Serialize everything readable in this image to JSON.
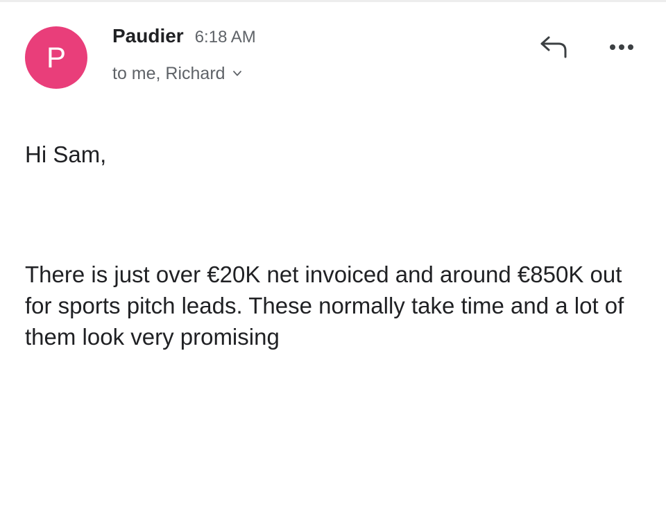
{
  "email": {
    "sender": {
      "initial": "P",
      "name": "Paudier",
      "time": "6:18 AM",
      "avatar_color": "#e93e7a"
    },
    "recipients": "to me, Richard",
    "actions": {
      "reply_icon": "reply-icon",
      "more_icon": "more-horizontal-icon"
    },
    "body": {
      "greeting": "Hi Sam,",
      "paragraph": "There is just over €20K net invoiced and around €850K out for sports pitch leads. These normally take time and a lot of them look very promising"
    }
  }
}
